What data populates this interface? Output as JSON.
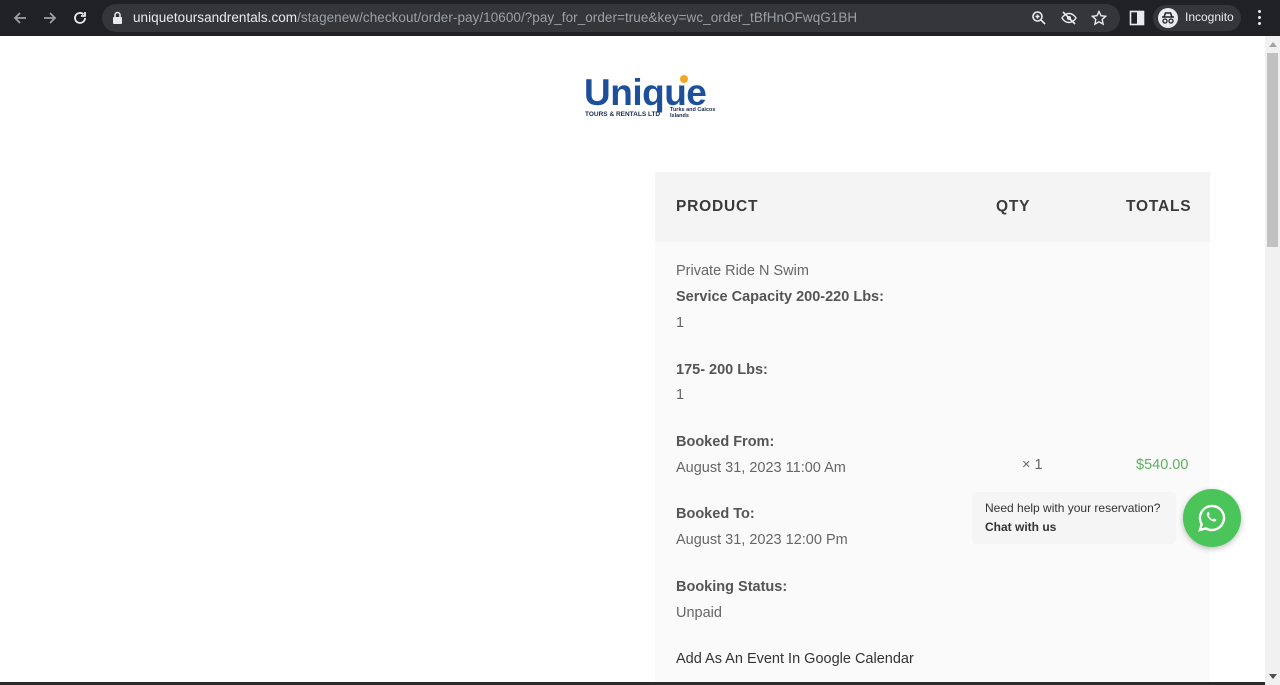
{
  "browser": {
    "url_host": "uniquetoursandrentals.com",
    "url_path": "/stagenew/checkout/order-pay/10600/?pay_for_order=true&key=wc_order_tBfHnOFwqG1BH",
    "profile_label": "Incognito",
    "icons": [
      "back-arrow-icon",
      "forward-arrow-icon",
      "reload-icon",
      "lock-icon",
      "zoom-icon",
      "eye-off-icon",
      "star-icon",
      "side-panel-icon",
      "incognito-icon",
      "more-menu-icon"
    ]
  },
  "logo": {
    "word": "Unique",
    "tagline": "TOURS & RENTALS LTD",
    "location": "Turks and Caicos Islands",
    "colors": {
      "word": "#1d4f9b",
      "sun": "#f5a623"
    }
  },
  "order": {
    "headers": {
      "product": "PRODUCT",
      "qty": "QTY",
      "totals": "TOTALS"
    },
    "product_name": "Private Ride N Swim",
    "service_capacity_label": "Service Capacity 200-220 Lbs:",
    "service_capacity_value": "1",
    "weight_label": "175- 200 Lbs:",
    "weight_value": "1",
    "booked_from_label": "Booked From:",
    "booked_from_value": "August 31, 2023 11:00 Am",
    "booked_to_label": "Booked To:",
    "booked_to_value": "August 31, 2023 12:00 Pm",
    "booking_status_label": "Booking Status:",
    "booking_status_value": "Unpaid",
    "calendar_link": "Add As An Event In Google Calendar",
    "qty": "× 1",
    "total": "$540.00",
    "colors": {
      "total": "#5cb15c",
      "header_bg": "#f4f4f4",
      "row_bg": "#fafafa"
    }
  },
  "chat": {
    "help_text": "Need help with your reservation?",
    "cta": "Chat with us",
    "button_icon": "whatsapp-icon",
    "color": "#4bc559"
  }
}
